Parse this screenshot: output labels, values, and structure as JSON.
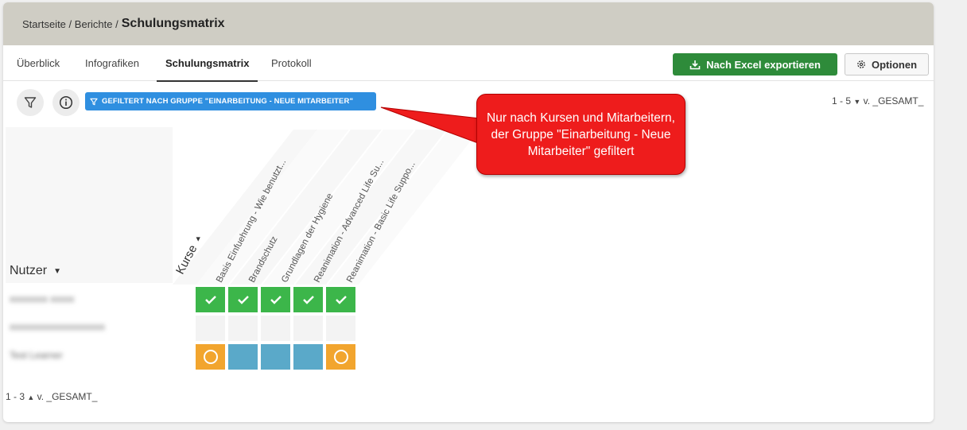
{
  "breadcrumb": {
    "home": "Startseite",
    "reports": "Berichte",
    "sep": "/",
    "current": "Schulungsmatrix"
  },
  "tabs": [
    {
      "label": "Überblick"
    },
    {
      "label": "Infografiken"
    },
    {
      "label": "Schulungsmatrix",
      "active": true
    },
    {
      "label": "Protokoll"
    }
  ],
  "toolbar": {
    "export_label": "Nach Excel exportieren",
    "options_label": "Optionen"
  },
  "filter": {
    "badge_label": "GEFILTERT NACH GRUPPE \"EINARBEITUNG - NEUE MITARBEITER\""
  },
  "pager_top": {
    "range": "1 - 5",
    "of": "v. _GESAMT_"
  },
  "pager_bottom": {
    "range": "1 - 3",
    "of": "v. _GESAMT_"
  },
  "matrix": {
    "row_header": "Nutzer",
    "col_header": "Kurse",
    "courses": [
      "Basis Einfuehrung - Wie benutzt...",
      "Brandschutz",
      "Grundlagen der Hygiene",
      "Reanimation - Advanced Life Su...",
      "Reanimation - Basic Life Suppo..."
    ],
    "users": [
      "xxxxxxxx xxxxx",
      "xxxxxxxxxxxxxxxxxxxx",
      "Test Learner"
    ],
    "statuses": [
      [
        "done",
        "done",
        "done",
        "done",
        "done"
      ],
      [
        "empty",
        "empty",
        "empty",
        "empty",
        "empty"
      ],
      [
        "progress",
        "assigned",
        "assigned",
        "assigned",
        "progress"
      ]
    ]
  },
  "annotation": {
    "text": "Nur nach Kursen und Mitarbeitern, der Gruppe \"Einarbeitung - Neue Mitarbeiter\" gefiltert",
    "color": "#ee1c1c"
  },
  "colors": {
    "done": "#3cb64a",
    "progress": "#f2a52e",
    "assigned": "#5aa9c9",
    "export": "#2e8b3a",
    "filter": "#2f8fe0"
  }
}
